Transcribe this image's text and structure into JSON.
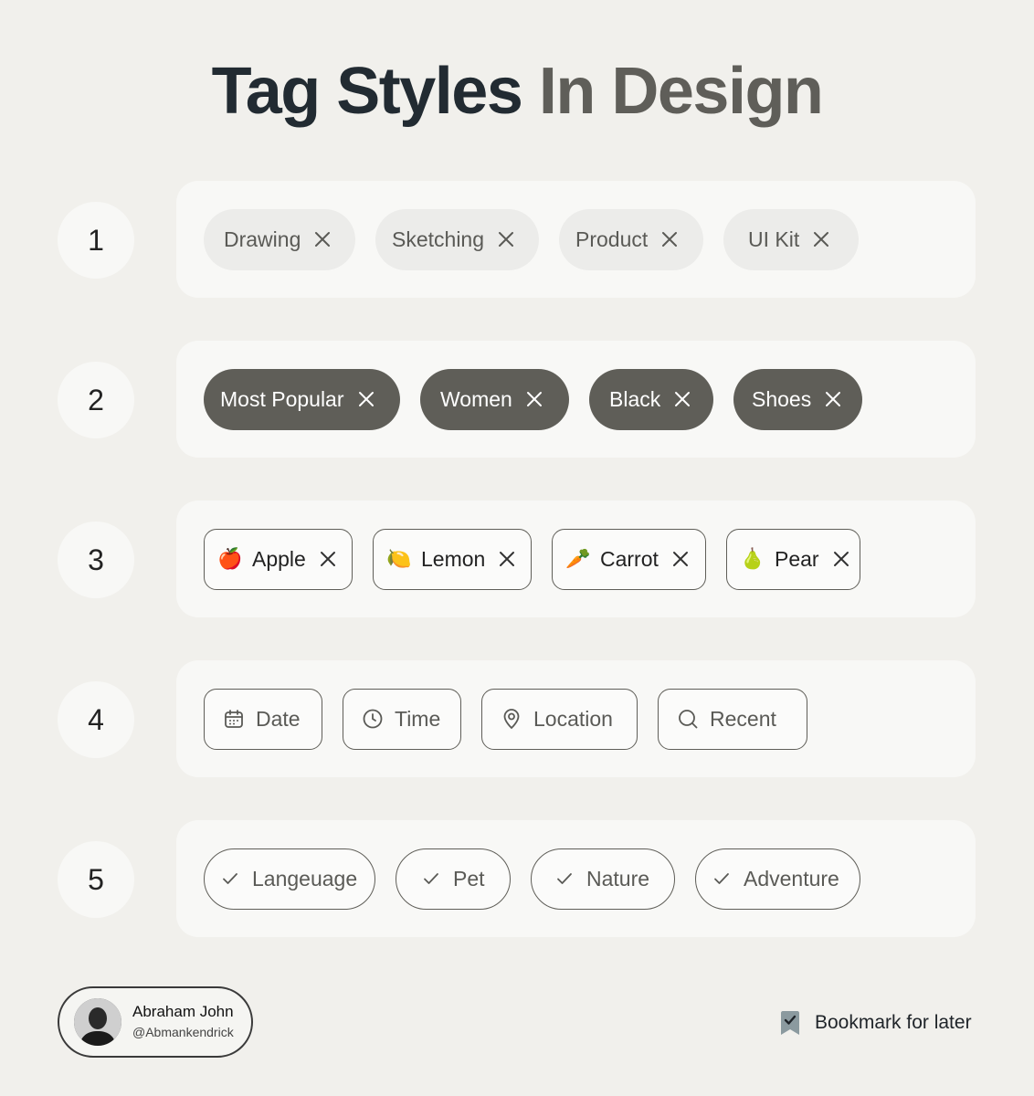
{
  "title": {
    "part1": "Tag Styles",
    "part2": "In Design"
  },
  "rows": [
    {
      "number": "1",
      "style": "soft-pill",
      "tags": [
        "Drawing",
        "Sketching",
        "Product",
        "UI Kit"
      ]
    },
    {
      "number": "2",
      "style": "filled-pill",
      "tags": [
        "Most Popular",
        "Women",
        "Black",
        "Shoes"
      ]
    },
    {
      "number": "3",
      "style": "outlined-emoji",
      "tags": [
        {
          "emoji": "🍎",
          "label": "Apple"
        },
        {
          "emoji": "🍋",
          "label": "Lemon"
        },
        {
          "emoji": "🥕",
          "label": "Carrot"
        },
        {
          "emoji": "🍐",
          "label": "Pear"
        }
      ]
    },
    {
      "number": "4",
      "style": "outlined-icon",
      "tags": [
        {
          "icon": "calendar-icon",
          "label": "Date"
        },
        {
          "icon": "clock-icon",
          "label": "Time"
        },
        {
          "icon": "location-pin-icon",
          "label": "Location"
        },
        {
          "icon": "search-icon",
          "label": "Recent"
        }
      ]
    },
    {
      "number": "5",
      "style": "outlined-check-pill",
      "tags": [
        "Langeuage",
        "Pet",
        "Nature",
        "Adventure"
      ]
    }
  ],
  "author": {
    "name": "Abraham John",
    "handle": "@Abmankendrick"
  },
  "bookmark": {
    "label": "Bookmark for later",
    "icon": "bookmark-icon"
  },
  "colors": {
    "background": "#f1f0ec",
    "card": "#f8f8f6",
    "dark_tag": "#5f5e58",
    "soft_tag": "#ececea",
    "title_dark": "#222b32",
    "title_gray": "#5f5e59"
  }
}
